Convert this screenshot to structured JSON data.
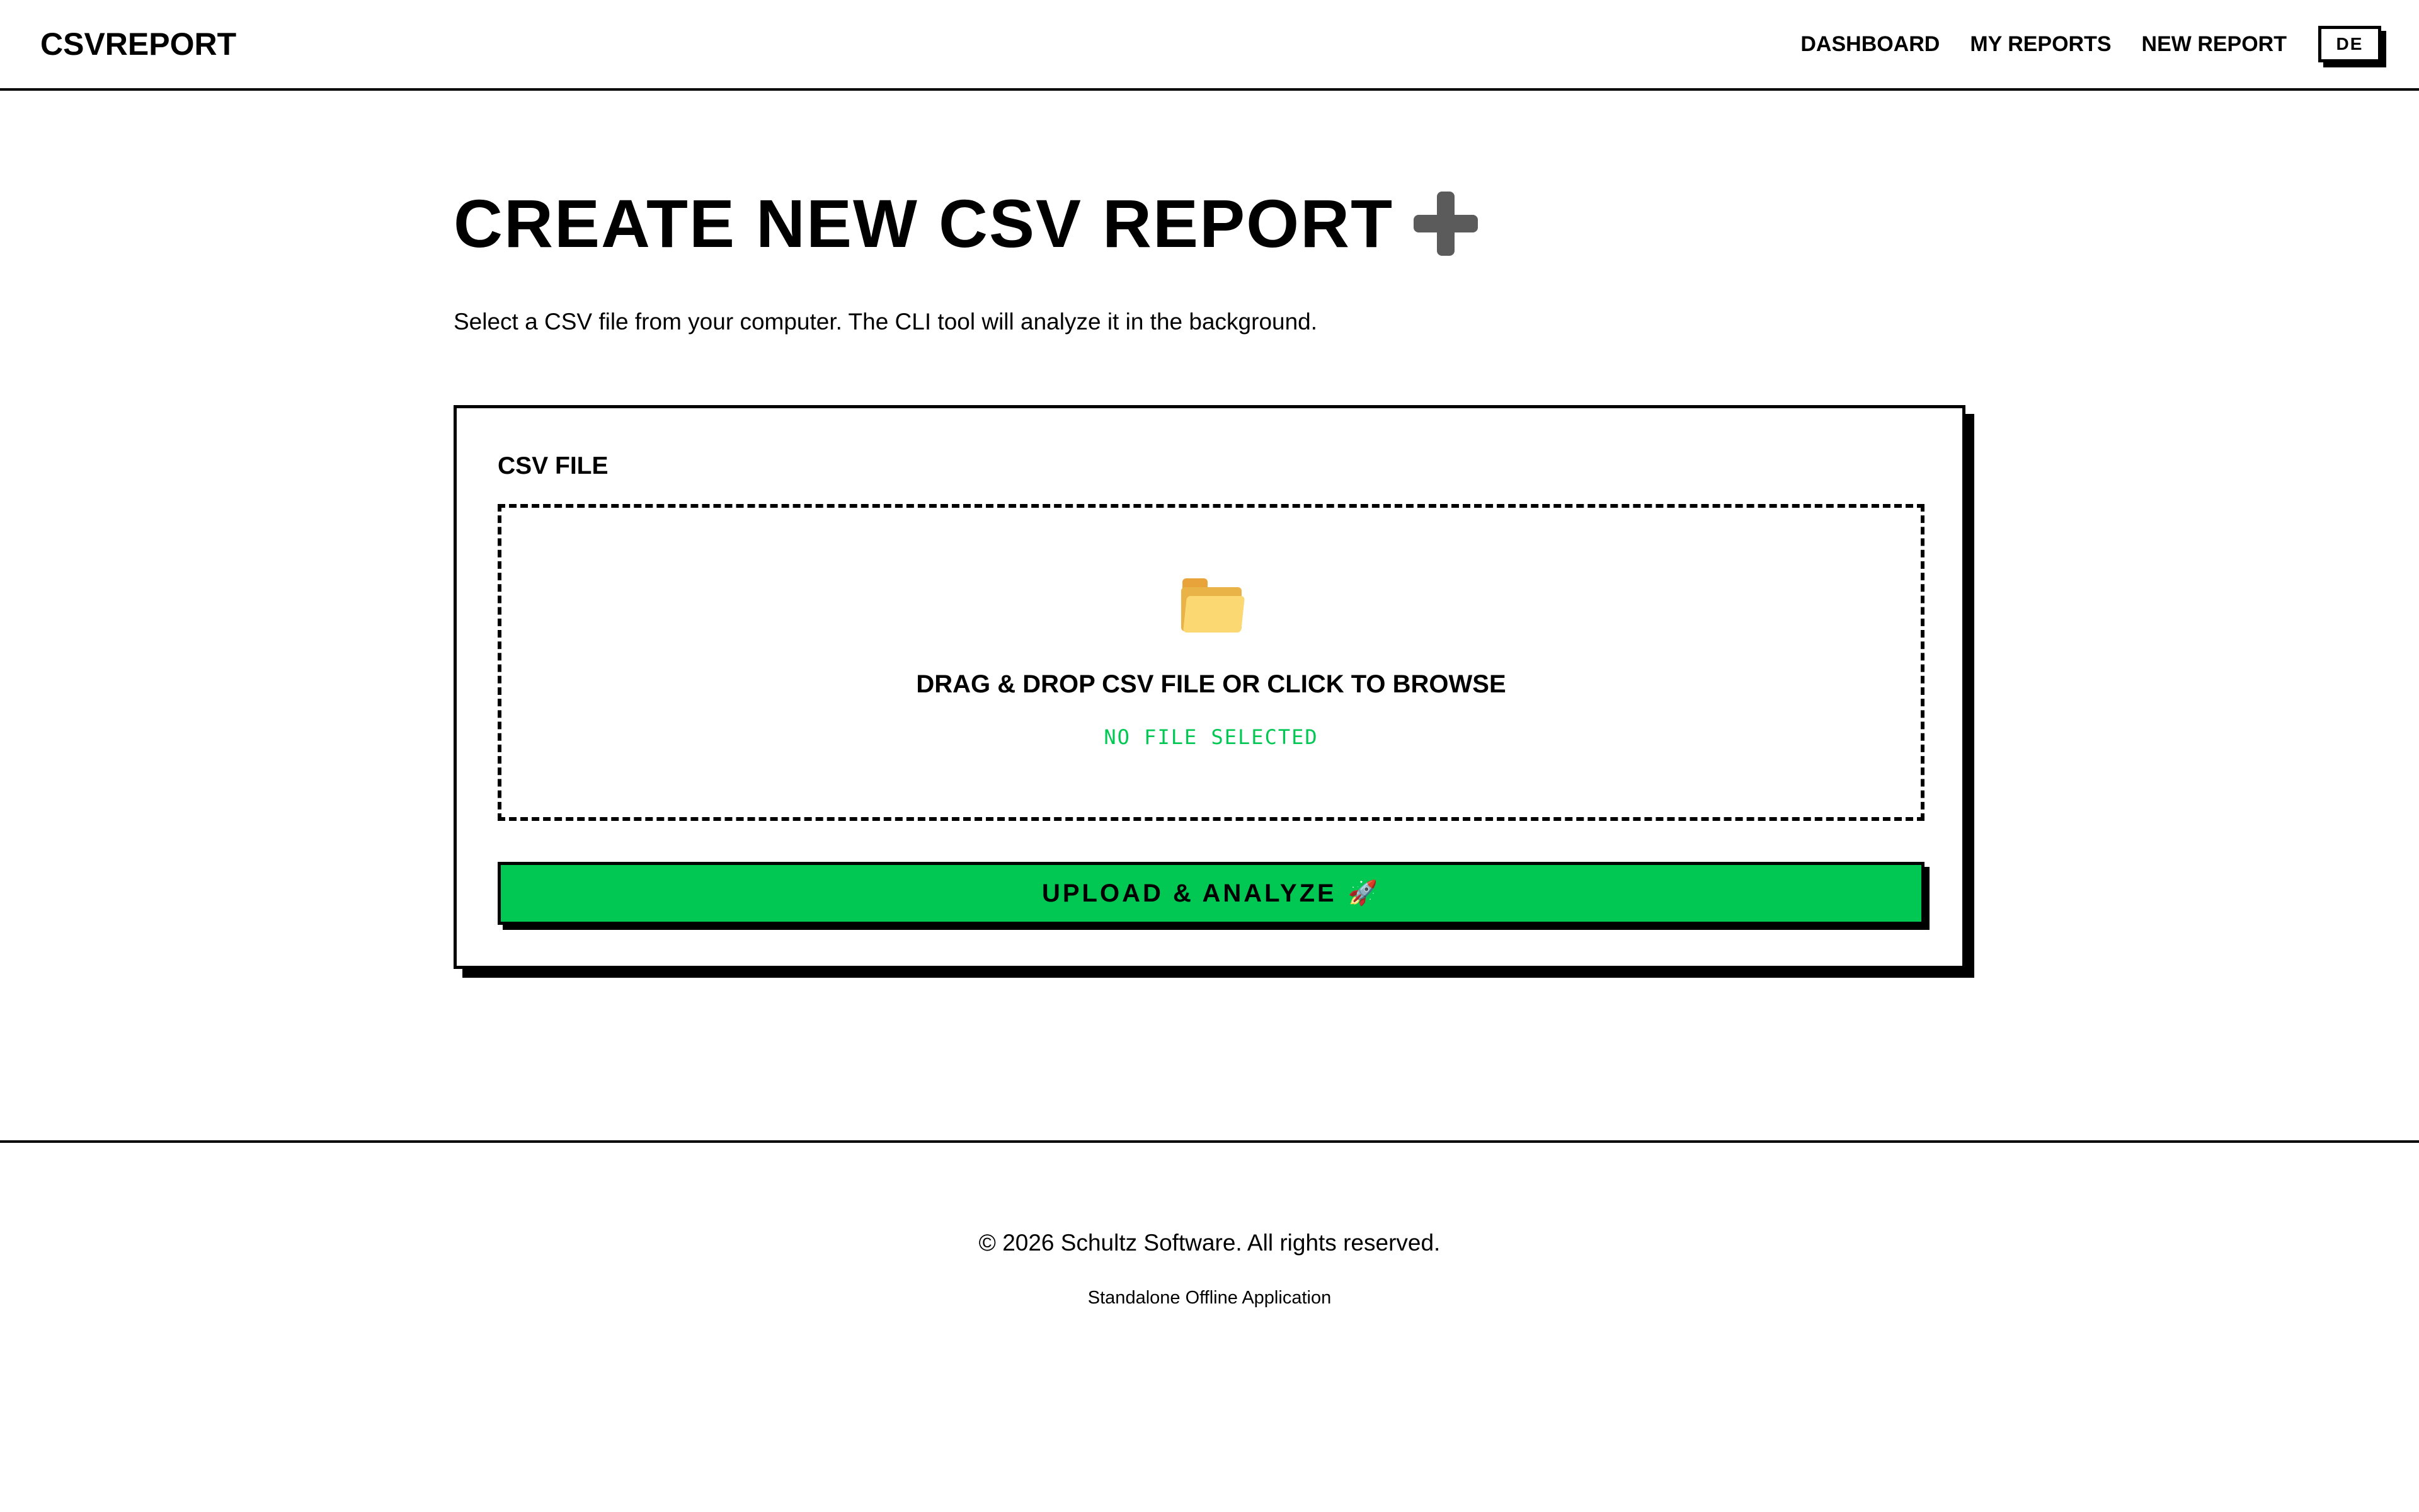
{
  "header": {
    "brand": "CSVREPORT",
    "nav": {
      "dashboard": "DASHBOARD",
      "my_reports": "MY REPORTS",
      "new_report": "NEW REPORT"
    },
    "language_button": "DE"
  },
  "main": {
    "title": "CREATE NEW CSV REPORT",
    "title_icon": "plus-icon",
    "subtitle": "Select a CSV file from your computer. The CLI tool will analyze it in the background.",
    "form": {
      "field_label": "CSV FILE",
      "dropzone": {
        "icon": "folder-icon",
        "instruction": "DRAG & DROP CSV FILE OR CLICK TO BROWSE",
        "status": "NO FILE SELECTED"
      },
      "submit_label": "UPLOAD & ANALYZE",
      "submit_icon": "🚀"
    }
  },
  "footer": {
    "copyright": "© 2026 Schultz Software. All rights reserved.",
    "note": "Standalone Offline Application"
  },
  "colors": {
    "accent": "#00c853",
    "text": "#000000",
    "background": "#ffffff"
  }
}
